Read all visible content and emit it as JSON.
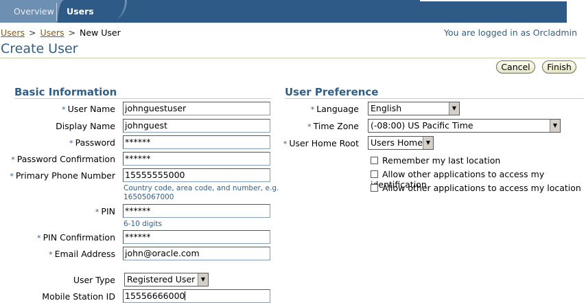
{
  "tabs": [
    {
      "label": "Overview"
    },
    {
      "label": "Users"
    }
  ],
  "breadcrumb": {
    "items": [
      "Users",
      "Users"
    ],
    "separator": ">",
    "current": "New User"
  },
  "login_info": "You are logged in as Orcladmin",
  "page_title": "Create User",
  "buttons": {
    "cancel": "Cancel",
    "finish": "Finish"
  },
  "basic_information": {
    "title": "Basic Information",
    "required_marker": "*",
    "fields": {
      "user_name": {
        "label": "User Name",
        "value": "johnguestuser"
      },
      "display_name": {
        "label": "Display Name",
        "value": "johnguest"
      },
      "password": {
        "label": "Password",
        "value": "******"
      },
      "password_confirmation": {
        "label": "Password Confirmation",
        "value": "******"
      },
      "primary_phone": {
        "label": "Primary Phone Number",
        "value": "15555555000",
        "hint_line1": "Country code, area code, and number, e.g.",
        "hint_line2": "16505067000"
      },
      "pin": {
        "label": "PIN",
        "value": "******",
        "hint": "6-10 digits"
      },
      "pin_confirmation": {
        "label": "PIN Confirmation",
        "value": "******"
      },
      "email": {
        "label": "Email Address",
        "value": "john@oracle.com"
      },
      "user_type": {
        "label": "User Type",
        "value": "Registered User"
      },
      "mobile_station_id": {
        "label": "Mobile Station ID",
        "value": "15556666000"
      }
    }
  },
  "user_preference": {
    "title": "User Preference",
    "fields": {
      "language": {
        "label": "Language",
        "value": "English"
      },
      "time_zone": {
        "label": "Time Zone",
        "value": "(-08:00) US Pacific Time"
      },
      "home_root": {
        "label": "User Home Root",
        "value": "Users Home"
      }
    },
    "checkboxes": [
      {
        "label": "Remember my last location",
        "checked": false
      },
      {
        "label": "Allow other applications to access my identification",
        "checked": false
      },
      {
        "label": "Allow other applications to access my location",
        "checked": false
      }
    ]
  },
  "colors": {
    "header_blue": "#2d5a86",
    "title_blue": "#2f5e8a",
    "link_brown": "#8a5a14"
  }
}
